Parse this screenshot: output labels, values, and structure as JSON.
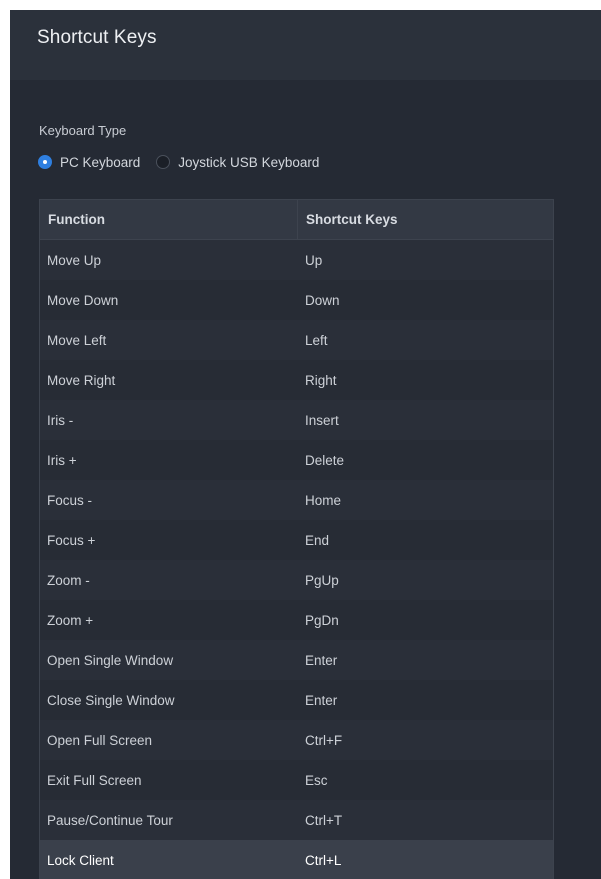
{
  "panel": {
    "title": "Shortcut Keys"
  },
  "keyboard_type": {
    "label": "Keyboard Type",
    "options": [
      {
        "label": "PC Keyboard",
        "selected": true
      },
      {
        "label": "Joystick USB Keyboard",
        "selected": false
      }
    ]
  },
  "table": {
    "headers": {
      "function": "Function",
      "shortcut": "Shortcut Keys"
    },
    "rows": [
      {
        "function": "Move Up",
        "shortcut": "Up"
      },
      {
        "function": "Move Down",
        "shortcut": "Down"
      },
      {
        "function": "Move Left",
        "shortcut": "Left"
      },
      {
        "function": "Move Right",
        "shortcut": "Right"
      },
      {
        "function": "Iris -",
        "shortcut": "Insert"
      },
      {
        "function": "Iris +",
        "shortcut": "Delete"
      },
      {
        "function": "Focus -",
        "shortcut": "Home"
      },
      {
        "function": "Focus +",
        "shortcut": "End"
      },
      {
        "function": "Zoom -",
        "shortcut": "PgUp"
      },
      {
        "function": "Zoom +",
        "shortcut": "PgDn"
      },
      {
        "function": "Open Single Window",
        "shortcut": "Enter"
      },
      {
        "function": "Close Single Window",
        "shortcut": "Enter"
      },
      {
        "function": "Open Full Screen",
        "shortcut": "Ctrl+F"
      },
      {
        "function": "Exit Full Screen",
        "shortcut": "Esc"
      },
      {
        "function": "Pause/Continue Tour",
        "shortcut": "Ctrl+T"
      },
      {
        "function": "Lock Client",
        "shortcut": "Ctrl+L"
      }
    ],
    "selected_row_index": 15
  },
  "colors": {
    "panel_bg": "#252a34",
    "header_bg": "#2b313b",
    "accent": "#2f7fe0",
    "selected_row": "#3a404b"
  }
}
